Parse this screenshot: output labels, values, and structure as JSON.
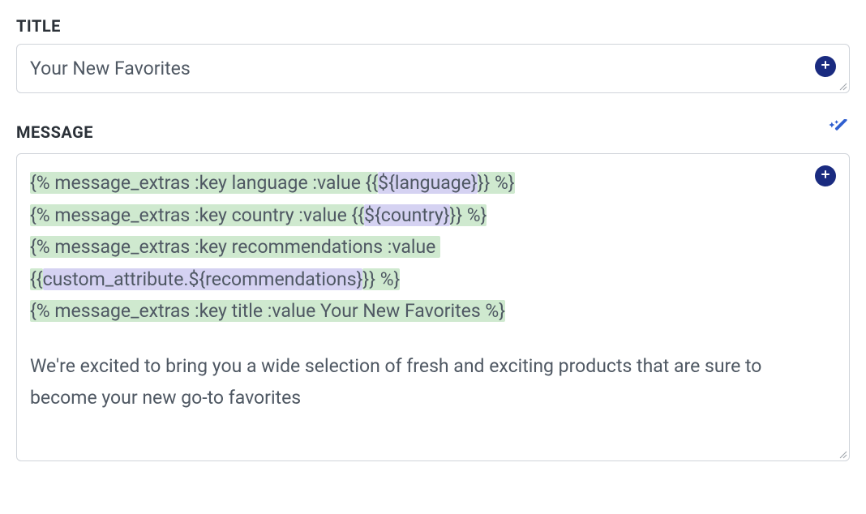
{
  "title": {
    "label": "TITLE",
    "value": "Your New Favorites"
  },
  "message": {
    "label": "MESSAGE",
    "segments": [
      [
        {
          "t": "{% message_extras :key language :value {{",
          "c": "green"
        },
        {
          "t": "${language}",
          "c": "purple"
        },
        {
          "t": "}} %}",
          "c": "green"
        }
      ],
      [
        {
          "t": "{% message_extras :key country :value {{",
          "c": "green"
        },
        {
          "t": "${country}",
          "c": "purple"
        },
        {
          "t": "}} %}",
          "c": "green"
        }
      ],
      [
        {
          "t": "{% message_extras :key recommendations :value ",
          "c": "green"
        }
      ],
      [
        {
          "t": "{{",
          "c": "green"
        },
        {
          "t": "custom_attribute.${recommendations}",
          "c": "purple"
        },
        {
          "t": "}} %}",
          "c": "green"
        }
      ],
      [
        {
          "t": "{% message_extras :key title :value Your New Favorites %}",
          "c": "green"
        }
      ]
    ],
    "body": "We're excited to bring you a wide selection of fresh and exciting products that are sure to become your new go-to favorites"
  },
  "icons": {
    "plus": "plus-circle-icon",
    "magic": "magic-wand-icon",
    "resize": "resize-handle-icon"
  }
}
